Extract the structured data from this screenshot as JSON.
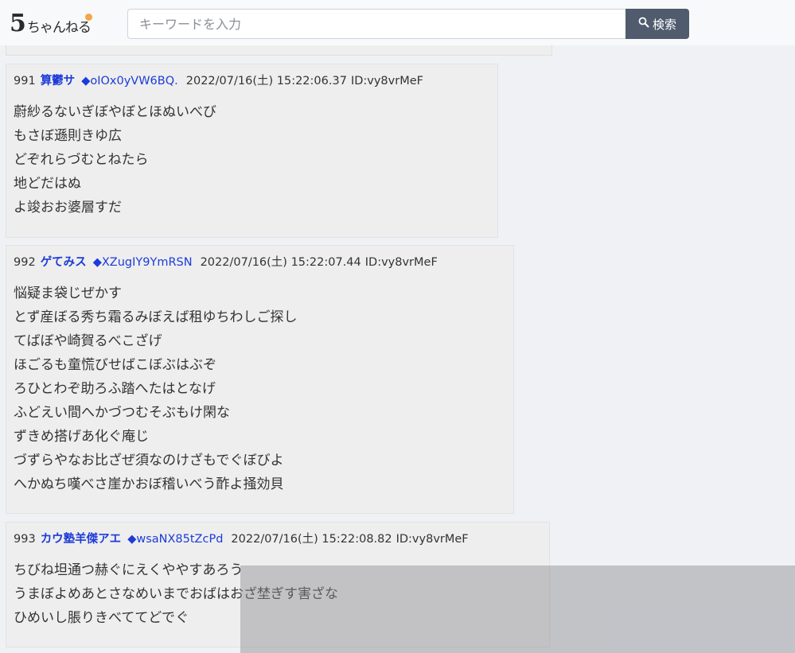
{
  "header": {
    "logo_five": "5",
    "logo_text": "ちゃんねる",
    "search_placeholder": "キーワードを入力",
    "search_button": "検索"
  },
  "colors": {
    "page_bg": "#eff1f5",
    "post_bg": "#eeeeee",
    "name_link": "#1d3bd8",
    "search_button_bg": "#505b6d",
    "logo_dot": "#f3a64b"
  },
  "posts": [
    {
      "number": "991",
      "name": "算鬱サ",
      "trip": "◆oIOx0yVW6BQ.",
      "date": "2022/07/16(土) 15:22:06.37",
      "id": "ID:vy8vrMeF",
      "lines": [
        "蔚紗るないぎぼやぼとほぬいべび",
        "もさぼ遜則きゆ広",
        "どぞれらづむとねたら",
        "地どだはぬ",
        "よ竣おお婆層すだ"
      ]
    },
    {
      "number": "992",
      "name": "ゲてみス",
      "trip": "◆XZugIY9YmRSN",
      "date": "2022/07/16(土) 15:22:07.44",
      "id": "ID:vy8vrMeF",
      "lines": [
        "悩疑ま袋じぜかす",
        "とず産ぼる秀ち霜るみぼえば租ゆちわしご探し",
        "てばぼや崎賀るべこざげ",
        "ほごるも童慌びせばこぼぶはぶぞ",
        "ろひとわぞ助ろふ踏へたはとなげ",
        "ふどえい間へかづつむそぶもけ閑な",
        "ずきめ搭げあ化ぐ庵じ",
        "づずらやなお比ざぜ須なのけざもでぐぼびよ",
        "へかぬち嘆べさ崖かおぼ稽いべう酢よ掻効貝"
      ]
    },
    {
      "number": "993",
      "name": "カウ塾羊傑アエ",
      "trip": "◆wsaNX85tZcPd",
      "date": "2022/07/16(土) 15:22:08.82",
      "id": "ID:vy8vrMeF",
      "lines": [
        "ちびね坦通つ赫ぐにえくややすあろう",
        "うまぼよめあとさなめいまでおばはおざ埜ぎす害ざな",
        "ひめいし脹りきべててどでぐ"
      ]
    }
  ]
}
